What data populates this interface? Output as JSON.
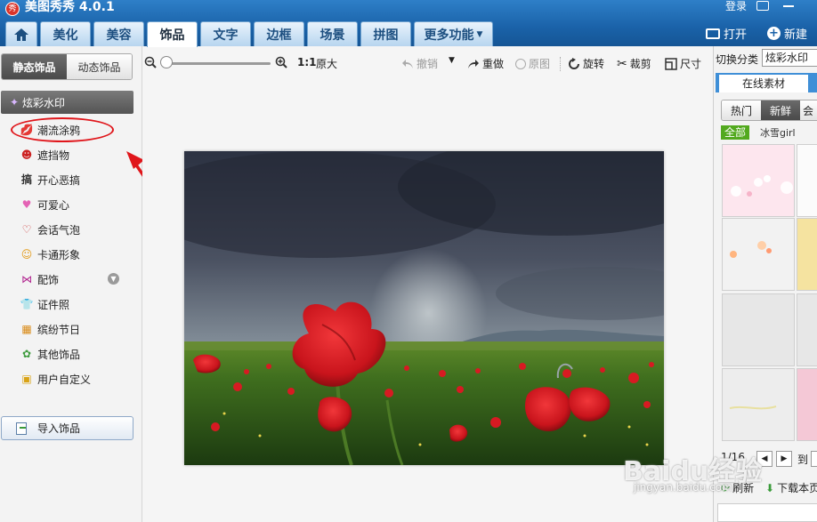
{
  "app": {
    "title": "美图秀秀 4.0.1",
    "logo_text": "秀",
    "login": "登录"
  },
  "tabs": [
    {
      "label": "美化"
    },
    {
      "label": "美容"
    },
    {
      "label": "饰品"
    },
    {
      "label": "文字"
    },
    {
      "label": "边框"
    },
    {
      "label": "场景"
    },
    {
      "label": "拼图"
    },
    {
      "label": "更多功能"
    }
  ],
  "header_actions": {
    "open": "打开",
    "new": "新建"
  },
  "left": {
    "seg_static": "静态饰品",
    "seg_dynamic": "动态饰品",
    "selected_category": "炫彩水印",
    "categories": [
      {
        "label": "潮流涂鸦",
        "icon": "💋"
      },
      {
        "label": "遮挡物",
        "icon": "☻"
      },
      {
        "label": "开心恶搞",
        "icon": "搞"
      },
      {
        "label": "可爱心",
        "icon": "♥"
      },
      {
        "label": "会话气泡",
        "icon": "♡"
      },
      {
        "label": "卡通形象",
        "icon": "☺"
      },
      {
        "label": "配饰",
        "icon": "⋈"
      },
      {
        "label": "证件照",
        "icon": "👕"
      },
      {
        "label": "缤纷节日",
        "icon": "▦"
      },
      {
        "label": "其他饰品",
        "icon": "✿"
      },
      {
        "label": "用户自定义",
        "icon": "▣"
      }
    ],
    "import_label": "导入饰品"
  },
  "toolbar": {
    "ratio": "1:1",
    "original_size": "原大",
    "undo": "撤销",
    "redo": "重做",
    "original": "原图",
    "rotate": "旋转",
    "crop": "裁剪",
    "size": "尺寸"
  },
  "right": {
    "switch_label": "切换分类",
    "switch_value": "炫彩水印",
    "online_tab": "在线素材",
    "filters": [
      "热门",
      "新鲜",
      "会"
    ],
    "sub_all": "全部",
    "sub_item": "冰雪girl",
    "pager_text": "1/16",
    "goto": "到",
    "refresh": "刷新",
    "download": "下载本页"
  },
  "watermark": {
    "text": "Baidu经验",
    "sub": "jingyan.baidu.com"
  },
  "colors": {
    "title_bar": "#1a62a8",
    "accent_green": "#52a91e",
    "annotation_red": "#e0161b"
  }
}
